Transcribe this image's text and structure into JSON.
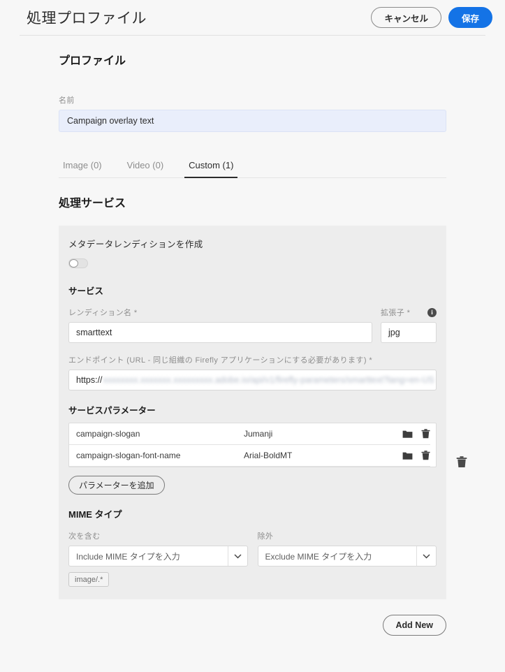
{
  "header": {
    "title": "処理プロファイル",
    "cancel_label": "キャンセル",
    "save_label": "保存",
    "save_color": "#1473e6"
  },
  "profile": {
    "section_title": "プロファイル",
    "name_label": "名前",
    "name_value": "Campaign overlay text",
    "name_field_bg": "#e9eefb"
  },
  "tabs": [
    {
      "label": "Image (0)",
      "active": false
    },
    {
      "label": "Video (0)",
      "active": false
    },
    {
      "label": "Custom (1)",
      "active": true
    }
  ],
  "processing": {
    "section_title": "処理サービス",
    "metadata_rendition_label": "メタデータレンディションを作成",
    "metadata_rendition_toggle": "off",
    "service_heading": "サービス",
    "rendition_name_label": "レンディション名 *",
    "rendition_name_value": "smarttext",
    "extension_label": "拡張子 *",
    "extension_value": "jpg",
    "info_icon_glyph": "i",
    "endpoint_label": "エンドポイント (URL - 同じ組織の Firefly アプリケーションにする必要があります) *",
    "endpoint_value_prefix": "https://",
    "endpoint_value_redacted": "xxxxxxxx.xxxxxxx.xxxxxxxxx.adobe.io/api/v1/firefly-parameters/smarttext?lang=en-US",
    "params_heading": "サービスパラメーター",
    "params": [
      {
        "key": "campaign-slogan",
        "value": "Jumanji"
      },
      {
        "key": "campaign-slogan-font-name",
        "value": "Arial-BoldMT"
      }
    ],
    "add_param_label": "パラメーターを追加",
    "mime_heading": "MIME タイプ",
    "include_label": "次を含む",
    "include_placeholder": "Include MIME タイプを入力",
    "include_tags": [
      "image/.*"
    ],
    "exclude_label": "除外",
    "exclude_placeholder": "Exclude MIME タイプを入力"
  },
  "footer": {
    "add_new_label": "Add New"
  }
}
